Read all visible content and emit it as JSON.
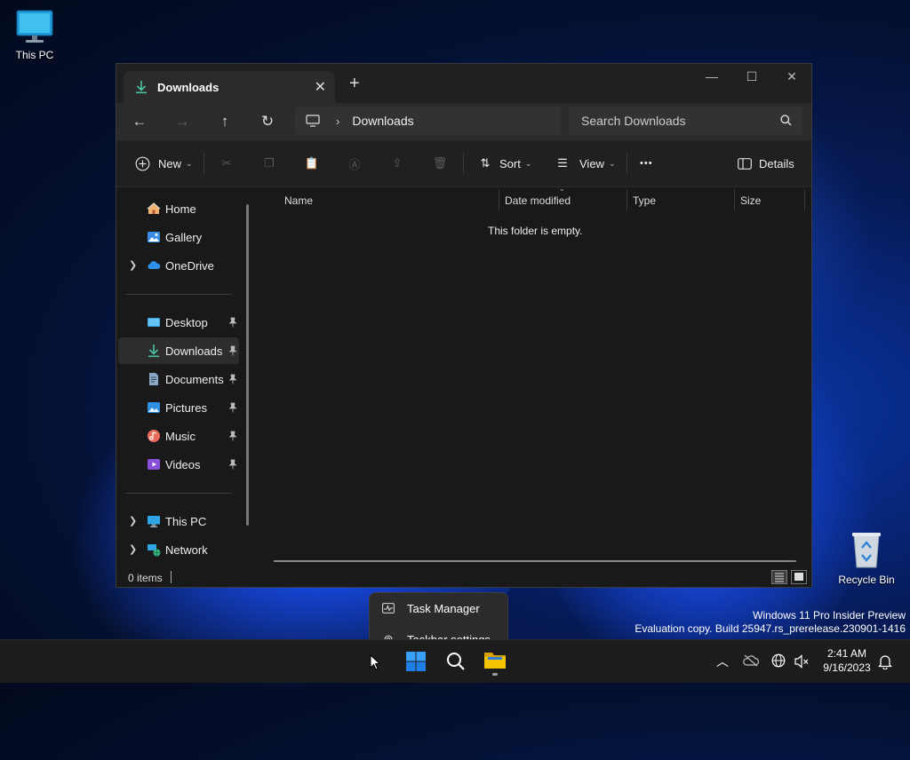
{
  "desktop": {
    "this_pc_label": "This PC",
    "recycle_bin_label": "Recycle Bin"
  },
  "window": {
    "tab_title": "Downloads",
    "address_path": "Downloads",
    "search_placeholder": "Search Downloads"
  },
  "toolbar": {
    "new_label": "New",
    "sort_label": "Sort",
    "view_label": "View",
    "more_label": "•••",
    "details_label": "Details"
  },
  "sidebar": {
    "home": "Home",
    "gallery": "Gallery",
    "onedrive": "OneDrive",
    "desktop": "Desktop",
    "downloads": "Downloads",
    "documents": "Documents",
    "pictures": "Pictures",
    "music": "Music",
    "videos": "Videos",
    "this_pc": "This PC",
    "network": "Network"
  },
  "columns": {
    "name": "Name",
    "date": "Date modified",
    "type": "Type",
    "size": "Size"
  },
  "content": {
    "empty_message": "This folder is empty."
  },
  "status": {
    "item_count": "0 items"
  },
  "context_menu": {
    "task_manager": "Task Manager",
    "taskbar_settings": "Taskbar settings"
  },
  "watermark": {
    "line1": "Windows 11 Pro Insider Preview",
    "line2": "Evaluation copy. Build 25947.rs_prerelease.230901-1416"
  },
  "clock": {
    "time": "2:41 AM",
    "date": "9/16/2023"
  },
  "colors": {
    "accent_green": "#4cc2a0",
    "folder_yellow": "#f5c400",
    "start_blue": "#3aa0ff"
  }
}
